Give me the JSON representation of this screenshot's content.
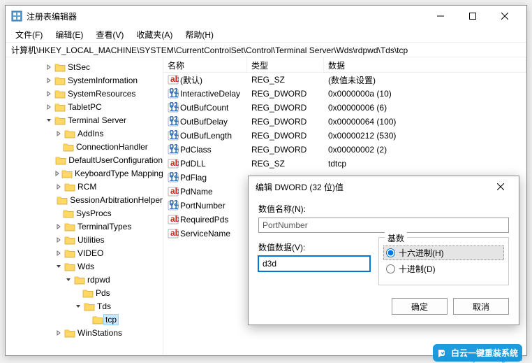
{
  "window": {
    "title": "注册表编辑器"
  },
  "menu": {
    "file": "文件(F)",
    "edit": "编辑(E)",
    "view": "查看(V)",
    "favorites": "收藏夹(A)",
    "help": "帮助(H)"
  },
  "path": "计算机\\HKEY_LOCAL_MACHINE\\SYSTEM\\CurrentControlSet\\Control\\Terminal Server\\Wds\\rdpwd\\Tds\\tcp",
  "tree": {
    "items": [
      {
        "indent": 4,
        "toggle": ">",
        "label": "StSec"
      },
      {
        "indent": 4,
        "toggle": ">",
        "label": "SystemInformation"
      },
      {
        "indent": 4,
        "toggle": ">",
        "label": "SystemResources"
      },
      {
        "indent": 4,
        "toggle": ">",
        "label": "TabletPC"
      },
      {
        "indent": 4,
        "toggle": "v",
        "label": "Terminal Server"
      },
      {
        "indent": 5,
        "toggle": ">",
        "label": "AddIns"
      },
      {
        "indent": 5,
        "toggle": "",
        "label": "ConnectionHandler"
      },
      {
        "indent": 5,
        "toggle": "",
        "label": "DefaultUserConfiguration"
      },
      {
        "indent": 5,
        "toggle": ">",
        "label": "KeyboardType Mapping"
      },
      {
        "indent": 5,
        "toggle": ">",
        "label": "RCM"
      },
      {
        "indent": 5,
        "toggle": "",
        "label": "SessionArbitrationHelper"
      },
      {
        "indent": 5,
        "toggle": "",
        "label": "SysProcs"
      },
      {
        "indent": 5,
        "toggle": ">",
        "label": "TerminalTypes"
      },
      {
        "indent": 5,
        "toggle": ">",
        "label": "Utilities"
      },
      {
        "indent": 5,
        "toggle": ">",
        "label": "VIDEO"
      },
      {
        "indent": 5,
        "toggle": "v",
        "label": "Wds"
      },
      {
        "indent": 6,
        "toggle": "v",
        "label": "rdpwd"
      },
      {
        "indent": 7,
        "toggle": "",
        "label": "Pds"
      },
      {
        "indent": 7,
        "toggle": "v",
        "label": "Tds"
      },
      {
        "indent": 8,
        "toggle": "",
        "label": "tcp",
        "selected": true
      },
      {
        "indent": 5,
        "toggle": ">",
        "label": "WinStations"
      }
    ]
  },
  "list": {
    "headers": {
      "name": "名称",
      "type": "类型",
      "data": "数据"
    },
    "rows": [
      {
        "icon": "str",
        "name": "(默认)",
        "type": "REG_SZ",
        "data": "(数值未设置)"
      },
      {
        "icon": "bin",
        "name": "InteractiveDelay",
        "type": "REG_DWORD",
        "data": "0x0000000a (10)"
      },
      {
        "icon": "bin",
        "name": "OutBufCount",
        "type": "REG_DWORD",
        "data": "0x00000006 (6)"
      },
      {
        "icon": "bin",
        "name": "OutBufDelay",
        "type": "REG_DWORD",
        "data": "0x00000064 (100)"
      },
      {
        "icon": "bin",
        "name": "OutBufLength",
        "type": "REG_DWORD",
        "data": "0x00000212 (530)"
      },
      {
        "icon": "bin",
        "name": "PdClass",
        "type": "REG_DWORD",
        "data": "0x00000002 (2)"
      },
      {
        "icon": "str",
        "name": "PdDLL",
        "type": "REG_SZ",
        "data": "tdtcp"
      },
      {
        "icon": "bin",
        "name": "PdFlag",
        "type": "",
        "data": ""
      },
      {
        "icon": "str",
        "name": "PdName",
        "type": "",
        "data": ""
      },
      {
        "icon": "bin",
        "name": "PortNumber",
        "type": "",
        "data": ""
      },
      {
        "icon": "str",
        "name": "RequiredPds",
        "type": "",
        "data": ""
      },
      {
        "icon": "str",
        "name": "ServiceName",
        "type": "",
        "data": ""
      }
    ]
  },
  "dialog": {
    "title": "编辑 DWORD (32 位)值",
    "name_label": "数值名称(N):",
    "name_value": "PortNumber",
    "data_label": "数值数据(V):",
    "data_value": "d3d",
    "base_label": "基数",
    "radio_hex": "十六进制(H)",
    "radio_dec": "十进制(D)",
    "ok": "确定",
    "cancel": "取消"
  },
  "watermark": {
    "text": "白云一键重装系统",
    "url": "www.baiyunxitong.com"
  }
}
